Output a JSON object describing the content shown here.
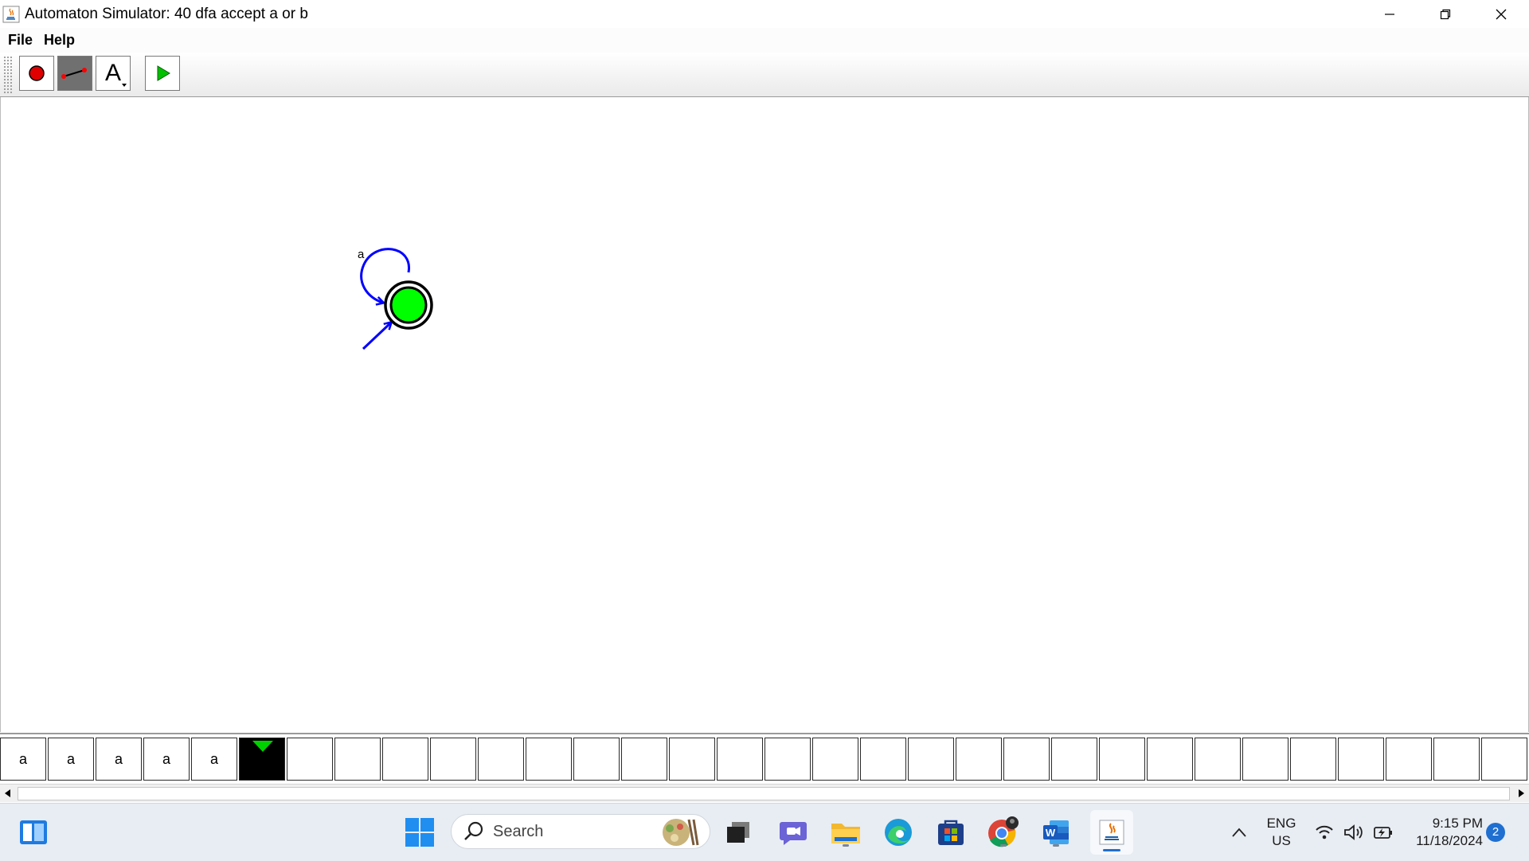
{
  "window": {
    "title": "Automaton Simulator: 40 dfa accept a or b",
    "controls": [
      "minimize-icon",
      "restore-icon",
      "close-icon"
    ]
  },
  "menubar": {
    "items": [
      "File",
      "Help"
    ]
  },
  "toolbar": {
    "tools": [
      {
        "name": "state-tool",
        "icon": "red-circle-icon",
        "selected": false
      },
      {
        "name": "transition-tool",
        "icon": "arrow-line-icon",
        "selected": true
      },
      {
        "name": "label-tool",
        "icon": "text-a-icon",
        "label": "A",
        "selected": false
      },
      {
        "name": "run-tool",
        "icon": "play-icon",
        "selected": false
      }
    ]
  },
  "automaton": {
    "states": [
      {
        "id": "q0",
        "initial": true,
        "accepting": true,
        "active": true
      }
    ],
    "transitions": [
      {
        "from": "q0",
        "to": "q0",
        "label": "a"
      }
    ],
    "colors": {
      "state_fill": "#00ff00",
      "transition": "#0000ff"
    }
  },
  "tape": {
    "cells": [
      "a",
      "a",
      "a",
      "a",
      "a",
      "",
      "",
      "",
      "",
      "",
      "",
      "",
      "",
      "",
      "",
      "",
      "",
      "",
      "",
      "",
      "",
      "",
      "",
      "",
      "",
      "",
      "",
      "",
      "",
      "",
      "",
      ""
    ],
    "head_index": 5
  },
  "taskbar": {
    "search_placeholder": "Search",
    "apps": [
      "windows-start-icon",
      "file-explorer-icon",
      "teams-chat-icon",
      "folder-icon",
      "edge-icon",
      "store-icon",
      "chrome-icon",
      "word-icon",
      "java-icon"
    ],
    "tray": {
      "language_line1": "ENG",
      "language_line2": "US",
      "time": "9:15 PM",
      "date": "11/18/2024",
      "notification_count": "2"
    }
  }
}
